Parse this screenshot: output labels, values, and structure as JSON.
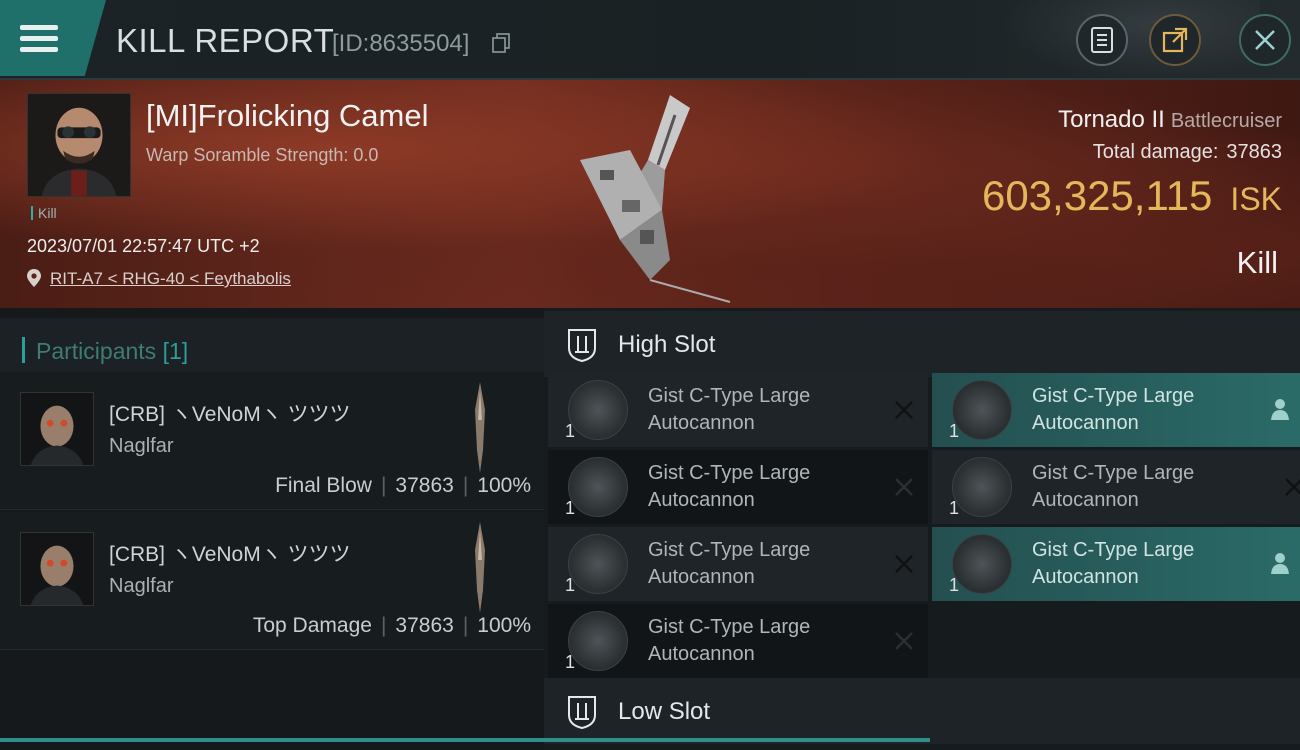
{
  "header": {
    "title": "KILL REPORT",
    "report_id": "[ID:8635504]"
  },
  "victim": {
    "pilot_name": "[MI]Frolicking Camel",
    "scramble_text": "Warp Soramble Strength: 0.0",
    "tag": "Kill",
    "timestamp": "2023/07/01 22:57:47 UTC +2",
    "location": "RIT-A7 < RHG-40 < Feythabolis",
    "ship_name": "Tornado II",
    "ship_class": "Battlecruiser",
    "total_damage_label": "Total damage:",
    "total_damage": "37863",
    "isk_value": "603,325,115",
    "isk_unit": "ISK",
    "result": "Kill"
  },
  "participants": {
    "title": "Participants",
    "count": "[1]",
    "rows": [
      {
        "name": "[CRB] ヽVeNoMヽ ツツツ",
        "ship": "Naglfar",
        "role": "Final Blow",
        "damage": "37863",
        "percent": "100%"
      },
      {
        "name": "[CRB] ヽVeNoMヽ ツツツ",
        "ship": "Naglfar",
        "role": "Top Damage",
        "damage": "37863",
        "percent": "100%"
      }
    ]
  },
  "slots": {
    "high_label": "High Slot",
    "low_label": "Low Slot",
    "modules": [
      {
        "name_line1": "Gist C-Type Large",
        "name_line2": "Autocannon",
        "qty": "1",
        "state": "destroyed"
      },
      {
        "name_line1": "Gist C-Type Large",
        "name_line2": "Autocannon",
        "qty": "1",
        "state": "dropped"
      },
      {
        "name_line1": "Gist C-Type Large",
        "name_line2": "Autocannon",
        "qty": "1",
        "state": "destroyed"
      },
      {
        "name_line1": "Gist C-Type Large",
        "name_line2": "Autocannon",
        "qty": "1",
        "state": "destroyed"
      },
      {
        "name_line1": "Gist C-Type Large",
        "name_line2": "Autocannon",
        "qty": "1",
        "state": "destroyed"
      },
      {
        "name_line1": "Gist C-Type Large",
        "name_line2": "Autocannon",
        "qty": "1",
        "state": "dropped"
      },
      {
        "name_line1": "Gist C-Type Large",
        "name_line2": "Autocannon",
        "qty": "1",
        "state": "destroyed"
      }
    ]
  },
  "colors": {
    "accent_teal": "#2b9f98",
    "isk_gold": "#e6b75a"
  },
  "icons": [
    "menu-icon",
    "copy-icon",
    "document-icon",
    "share-icon",
    "close-icon",
    "location-pin-icon",
    "shield-slot-icon",
    "x-icon",
    "person-icon"
  ]
}
